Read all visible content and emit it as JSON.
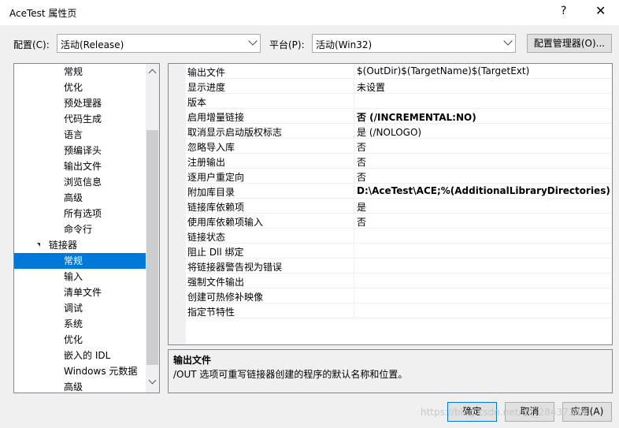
{
  "window": {
    "title": "AceTest 属性页",
    "help": "?",
    "close": "✕"
  },
  "config": {
    "label": "配置(C):",
    "value": "活动(Release)",
    "platform_label": "平台(P):",
    "platform_value": "活动(Win32)",
    "manager_button": "配置管理器(O)..."
  },
  "tree": {
    "items_before": [
      "常规",
      "优化",
      "预处理器",
      "代码生成",
      "语言",
      "预编译头",
      "输出文件",
      "浏览信息",
      "高级",
      "所有选项",
      "命令行"
    ],
    "group": "链接器",
    "items_after": [
      "常规",
      "输入",
      "清单文件",
      "调试",
      "系统",
      "优化",
      "嵌入的 IDL",
      "Windows 元数据",
      "高级"
    ]
  },
  "grid": {
    "rows": [
      {
        "name": "输出文件",
        "value": "$(OutDir)$(TargetName)$(TargetExt)",
        "bold": false
      },
      {
        "name": "显示进度",
        "value": "未设置",
        "bold": false
      },
      {
        "name": "版本",
        "value": "",
        "bold": false
      },
      {
        "name": "启用增量链接",
        "value": "否 (/INCREMENTAL:NO)",
        "bold": true
      },
      {
        "name": "取消显示启动版权标志",
        "value": "是 (/NOLOGO)",
        "bold": false
      },
      {
        "name": "忽略导入库",
        "value": "否",
        "bold": false
      },
      {
        "name": "注册输出",
        "value": "否",
        "bold": false
      },
      {
        "name": "逐用户重定向",
        "value": "否",
        "bold": false
      },
      {
        "name": "附加库目录",
        "value": "D:\\AceTest\\ACE;%(AdditionalLibraryDirectories)",
        "bold": true
      },
      {
        "name": "链接库依赖项",
        "value": "是",
        "bold": false
      },
      {
        "name": "使用库依赖项输入",
        "value": "否",
        "bold": false
      },
      {
        "name": "链接状态",
        "value": "",
        "bold": false
      },
      {
        "name": "阻止 Dll 绑定",
        "value": "",
        "bold": false
      },
      {
        "name": "将链接器警告视为错误",
        "value": "",
        "bold": false
      },
      {
        "name": "强制文件输出",
        "value": "",
        "bold": false
      },
      {
        "name": "创建可热修补映像",
        "value": "",
        "bold": false
      },
      {
        "name": "指定节特性",
        "value": "",
        "bold": false
      }
    ]
  },
  "description": {
    "title": "输出文件",
    "text": "/OUT 选项可重写链接器创建的程序的默认名称和位置。"
  },
  "buttons": {
    "ok": "确定",
    "cancel": "取消",
    "apply": "应用(A)"
  },
  "watermark": "https://blog.csdn.net/qq_28437139"
}
